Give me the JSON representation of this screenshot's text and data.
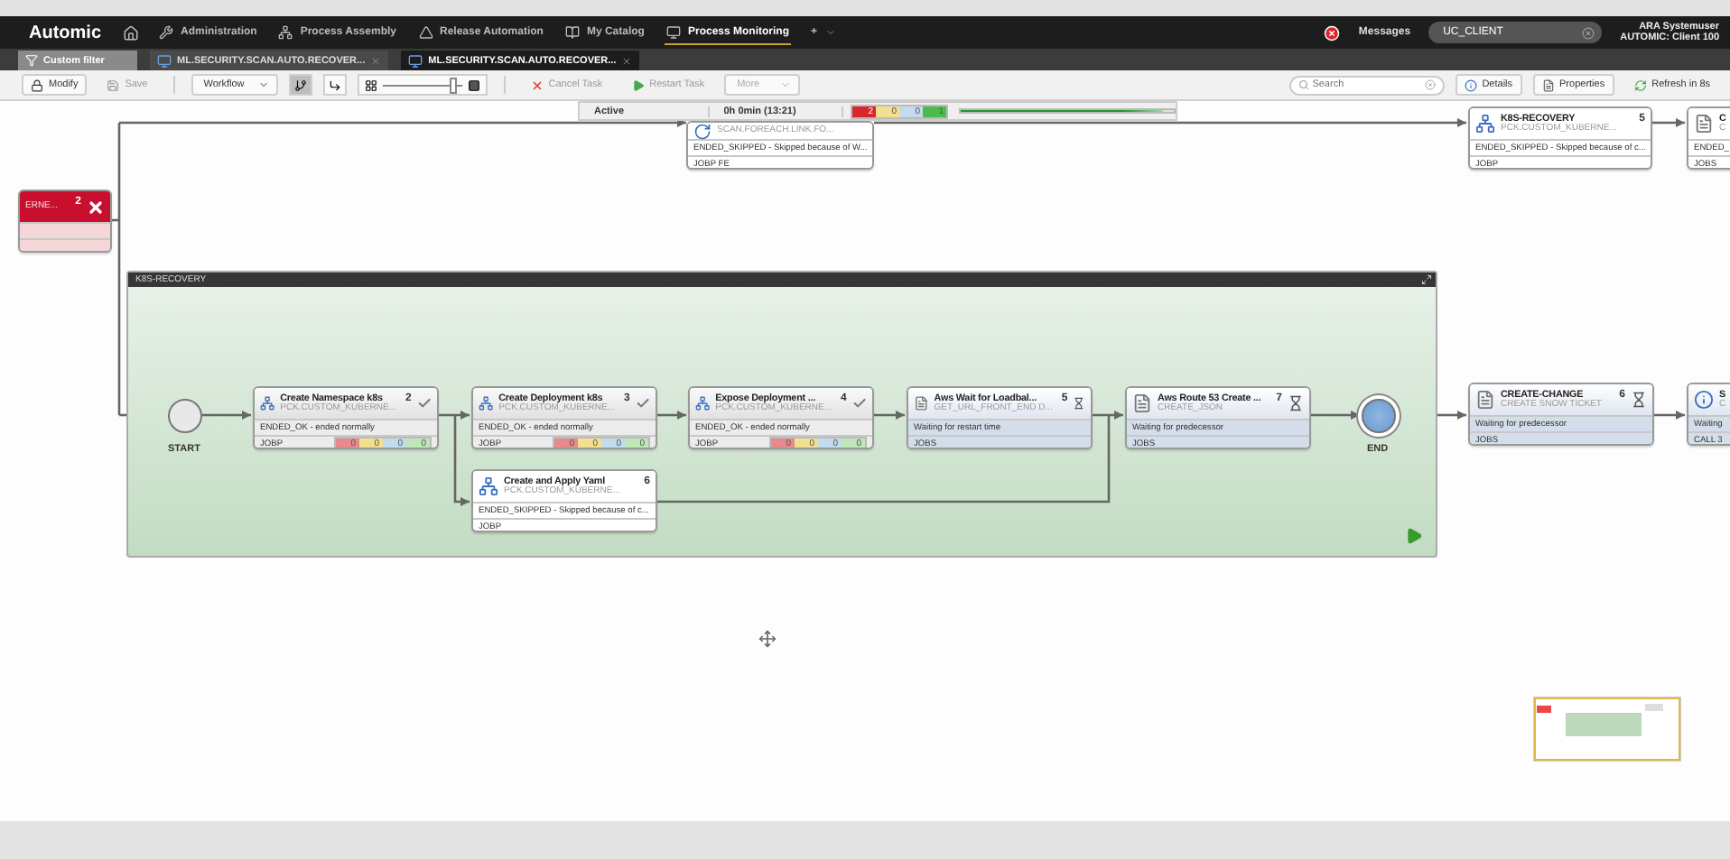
{
  "nav": {
    "logo": "Automic",
    "items": [
      {
        "label": "Administration",
        "selected": false
      },
      {
        "label": "Process Assembly",
        "selected": false
      },
      {
        "label": "Release Automation",
        "selected": false
      },
      {
        "label": "My Catalog",
        "selected": false
      },
      {
        "label": "Process Monitoring",
        "selected": true
      }
    ],
    "add": "+",
    "messages": "Messages",
    "client": "UC_CLIENT",
    "user": "ARA Systemuser",
    "system": "AUTOMIC: Client 100"
  },
  "tabs": [
    {
      "label": "Custom filter",
      "kind": "filter",
      "selected": false
    },
    {
      "label": "ML.SECURITY.SCAN.AUTO.RECOVER...",
      "kind": "workflow",
      "selected": false
    },
    {
      "label": "ML.SECURITY.SCAN.AUTO.RECOVER...",
      "kind": "workflow",
      "selected": true
    }
  ],
  "toolbar": {
    "left": [
      {
        "label": "Modify",
        "disabled": false
      },
      {
        "label": "Save",
        "disabled": true
      }
    ],
    "view": "Workflow",
    "modes": [
      {
        "selected": true
      },
      {
        "selected": false
      }
    ],
    "zoom": {
      "level": 0.9
    },
    "tasks": [
      {
        "label": "Cancel Task",
        "disabled": true
      },
      {
        "label": "Restart Task",
        "disabled": true
      }
    ],
    "more": {
      "label": "More",
      "disabled": true
    },
    "search": {
      "placeholder": "Search"
    },
    "right": [
      {
        "label": "Details"
      },
      {
        "label": "Properties"
      },
      {
        "label": "Refresh in 8s"
      }
    ]
  },
  "run": {
    "state": "Active",
    "duration": "0h 0min (13:21)",
    "counts": [
      {
        "value": "2",
        "color": "#d7262e"
      },
      {
        "value": "0",
        "color": "#f2e08e"
      },
      {
        "value": "0",
        "color": "#c2dcee"
      },
      {
        "value": "1",
        "color": "#4cbb4c"
      }
    ],
    "level": 0.95
  },
  "nodes": [
    {
      "kind": "skipped",
      "subtitle": "SCAN.FOREACH.LINK.FO...",
      "status": "ENDED_SKIPPED - Skipped because of W...",
      "type": "JOBP FE"
    },
    {
      "kind": "failed",
      "number": "2",
      "subtitle": "ERNE..."
    },
    {
      "kind": "skipped",
      "title": "K8S-RECOVERY",
      "number": "5",
      "subtitle": "PCK.CUSTOM_KUBERNE...",
      "status": "ENDED_SKIPPED - Skipped because of c...",
      "type": "JOBP"
    },
    {
      "kind": "skipped",
      "title": "C",
      "subtitle": "C",
      "status": "ENDED_",
      "type": "JOBS"
    }
  ],
  "group": {
    "title": "K8S-RECOVERY",
    "nodes": [
      {
        "kind": "start",
        "label": "START"
      },
      {
        "kind": "ok",
        "title": "Create Namespace k8s",
        "number": "2",
        "subtitle": "PCK.CUSTOM_KUBERNE...",
        "status": "ENDED_OK - ended normally",
        "type": "JOBP",
        "counts": [
          {
            "value": "0",
            "color": "#e88a8a"
          },
          {
            "value": "0",
            "color": "#f2e08e"
          },
          {
            "value": "0",
            "color": "#c2dcee"
          },
          {
            "value": "0",
            "color": "#bfe8b8"
          }
        ]
      },
      {
        "kind": "ok",
        "title": "Create Deployment k8s",
        "number": "3",
        "subtitle": "PCK.CUSTOM_KUBERNE...",
        "status": "ENDED_OK - ended normally",
        "type": "JOBP",
        "counts": [
          {
            "value": "0",
            "color": "#e88a8a"
          },
          {
            "value": "0",
            "color": "#f2e08e"
          },
          {
            "value": "0",
            "color": "#c2dcee"
          },
          {
            "value": "0",
            "color": "#bfe8b8"
          }
        ]
      },
      {
        "kind": "ok",
        "title": "Expose Deployment ...",
        "number": "4",
        "subtitle": "PCK.CUSTOM_KUBERNE...",
        "status": "ENDED_OK - ended normally",
        "type": "JOBP",
        "counts": [
          {
            "value": "0",
            "color": "#e88a8a"
          },
          {
            "value": "0",
            "color": "#f2e08e"
          },
          {
            "value": "0",
            "color": "#c2dcee"
          },
          {
            "value": "0",
            "color": "#bfe8b8"
          }
        ]
      },
      {
        "kind": "skipped",
        "title": "Create and Apply Yaml",
        "number": "6",
        "subtitle": "PCK.CUSTOM_KUBERNE...",
        "status": "ENDED_SKIPPED - Skipped because of c...",
        "type": "JOBP"
      },
      {
        "kind": "waiting",
        "title": "Aws Wait for Loadbal...",
        "number": "5",
        "subtitle": "GET_URL_FRONT_END D...",
        "status": "Waiting for restart time",
        "type": "JOBS"
      },
      {
        "kind": "waiting",
        "title": "Aws Route 53 Create ...",
        "number": "7",
        "subtitle": "CREATE_JSON",
        "status": "Waiting for predecessor",
        "type": "JOBS"
      },
      {
        "kind": "end",
        "label": "END"
      }
    ]
  },
  "after": [
    {
      "kind": "waiting",
      "title": "CREATE-CHANGE",
      "number": "6",
      "subtitle": "CREATE SNOW TICKET",
      "status": "Waiting for predecessor",
      "type": "JOBS"
    },
    {
      "kind": "waiting",
      "title": "S",
      "subtitle": "C",
      "status": "Waiting",
      "type": "CALL 3"
    }
  ]
}
